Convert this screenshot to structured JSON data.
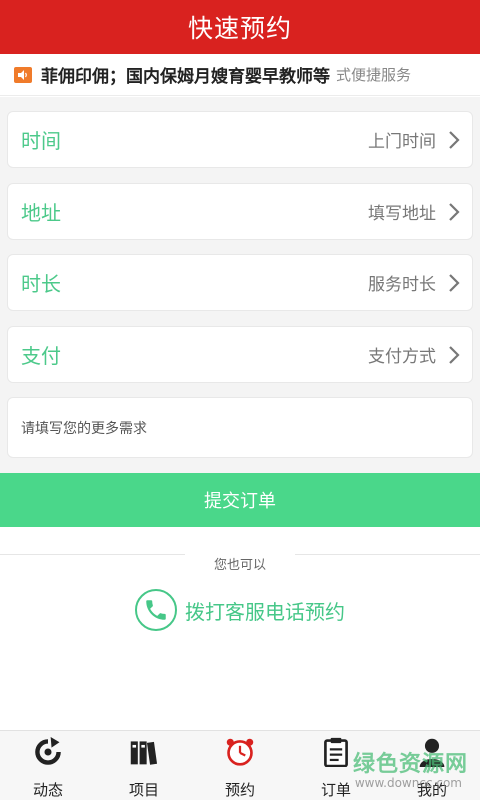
{
  "header": {
    "title": "快速预约"
  },
  "notice": {
    "text": "菲佣印佣；国内保姆月嫂育婴早教师等",
    "tail": "式便捷服务"
  },
  "form": {
    "rows": [
      {
        "label": "时间",
        "value": "上门时间"
      },
      {
        "label": "地址",
        "value": "填写地址"
      },
      {
        "label": "时长",
        "value": "服务时长"
      },
      {
        "label": "支付",
        "value": "支付方式"
      }
    ],
    "note_placeholder": "请填写您的更多需求"
  },
  "submit_label": "提交订单",
  "alt_text": "您也可以",
  "call_label": "拨打客服电话预约",
  "tabs": [
    {
      "label": "动态",
      "icon": "refresh-icon"
    },
    {
      "label": "项目",
      "icon": "books-icon"
    },
    {
      "label": "预约",
      "icon": "alarm-clock-icon"
    },
    {
      "label": "订单",
      "icon": "clipboard-icon"
    },
    {
      "label": "我的",
      "icon": "user-icon"
    }
  ],
  "watermark": {
    "main": "绿色资源网",
    "sub": "www.downcc.com"
  },
  "colors": {
    "header": "#d9221f",
    "accent": "#4ad78a",
    "label_green": "#4cc98a",
    "alarm_red": "#d9221f"
  }
}
